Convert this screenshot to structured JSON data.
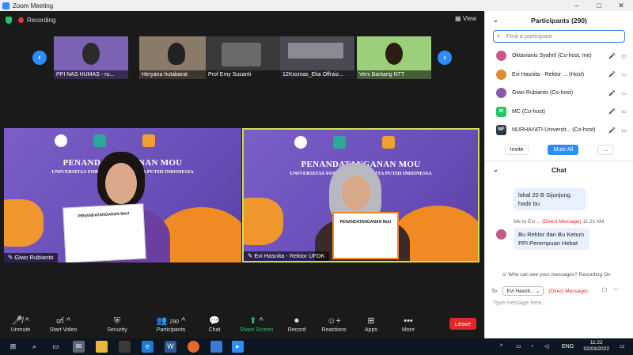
{
  "window": {
    "title": "Zoom Meeting",
    "minimize": "–",
    "maximize": "□",
    "close": "✕"
  },
  "meeting": {
    "recording_label": "Recording",
    "view_label": "View"
  },
  "strip": {
    "prev": "‹",
    "next": "›",
    "tiles": [
      {
        "name": "PPI NAS HUMAS - ru..."
      },
      {
        "name": "Heryana hutabarat"
      },
      {
        "name": "Prof Emy Susanti"
      },
      {
        "name": "12Kssmas_Eka Offraiz..."
      },
      {
        "name": "Veni Bantang NTT"
      }
    ]
  },
  "video": {
    "banner_title": "PENANDATANGANAN MOU",
    "banner_title_left": "PENANDATANGANAN MOU",
    "banner_sub": "UNIVERSITAS FORT DE KOCK & PITA PUTIH INDONESIA",
    "left_name": "Giwo Rubianto",
    "right_name": "Evi Hasnita - Rektor UFDK",
    "doc_title": "PENANDATANGANAN MoU"
  },
  "toolbar": {
    "unmute": "Unmute",
    "start_video": "Start Video",
    "security": "Security",
    "participants": "Participants",
    "participants_count": "290",
    "chat": "Chat",
    "share_screen": "Share Screen",
    "record": "Record",
    "reactions": "Reactions",
    "apps": "Apps",
    "more": "More",
    "leave": "Leave"
  },
  "participants_panel": {
    "header": "Participants (290)",
    "find_placeholder": "Find a participant",
    "rows": [
      {
        "name": "Oktavianis Syahril (Co-host, me)",
        "avatar_color": "#c55a8a",
        "initials": ""
      },
      {
        "name": "Evi Hasnita - Rektor ... (Host)",
        "avatar_color": "#e08a3a",
        "initials": ""
      },
      {
        "name": "Giwo Rubianto (Co-host)",
        "avatar_color": "#8a5aa8",
        "initials": ""
      },
      {
        "name": "MC (Co-host)",
        "avatar_color": "#23c465",
        "initials": "M"
      },
      {
        "name": "NURHAYATI-Universit... (Co-host)",
        "avatar_color": "#2a3a4a",
        "initials": "NF"
      }
    ],
    "invite": "Invite",
    "mute_all": "Mute All",
    "more": "..."
  },
  "chat_panel": {
    "header": "Chat",
    "prev_message": "lokal 20 B Sijunjung hadir bu",
    "meta_from": "Me to Evi ...",
    "meta_dm": "(Direct Message)",
    "meta_time": "11:21 AM",
    "message": "Bu Rektor dan Bu Ketum PPI Perempuan Hebat",
    "who_can_see": "Who can see your messages? Recording On",
    "to_label": "To:",
    "to_value": "Evi Hasnit...",
    "to_dm": "(Direct Message)",
    "input_placeholder": "Type message here..."
  },
  "taskbar": {
    "lang": "ENG",
    "time": "11:22",
    "date": "02/03/2022"
  }
}
